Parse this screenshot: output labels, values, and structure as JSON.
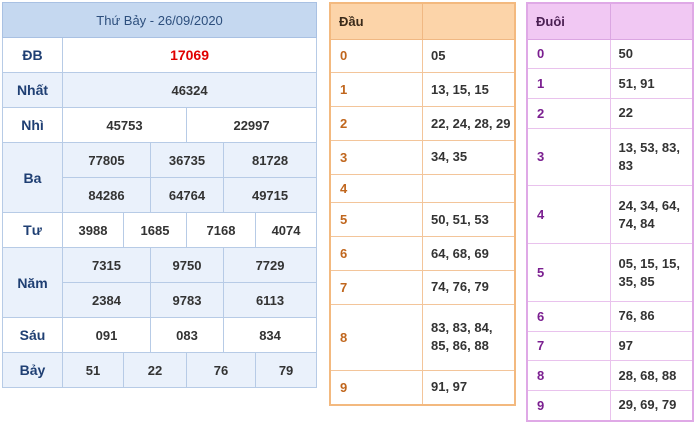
{
  "results": {
    "header": "Thứ Bảy - 26/09/2020",
    "db": {
      "label": "ĐB",
      "values": [
        "17069"
      ]
    },
    "nhat": {
      "label": "Nhất",
      "values": [
        "46324"
      ]
    },
    "nhi": {
      "label": "Nhì",
      "values": [
        "45753",
        "22997"
      ]
    },
    "ba": {
      "label": "Ba",
      "row1": [
        "77805",
        "36735",
        "81728"
      ],
      "row2": [
        "84286",
        "64764",
        "49715"
      ]
    },
    "tu": {
      "label": "Tư",
      "values": [
        "3988",
        "1685",
        "7168",
        "4074"
      ]
    },
    "nam": {
      "label": "Năm",
      "row1": [
        "7315",
        "9750",
        "7729"
      ],
      "row2": [
        "2384",
        "9783",
        "6113"
      ]
    },
    "sau": {
      "label": "Sáu",
      "values": [
        "091",
        "083",
        "834"
      ]
    },
    "bay": {
      "label": "Bảy",
      "values": [
        "51",
        "22",
        "76",
        "79"
      ]
    }
  },
  "dau": {
    "header": "Đầu",
    "rows": [
      {
        "k": "0",
        "v": "05"
      },
      {
        "k": "1",
        "v": "13, 15, 15"
      },
      {
        "k": "2",
        "v": "22, 24, 28, 29"
      },
      {
        "k": "3",
        "v": "34, 35"
      },
      {
        "k": "4",
        "v": ""
      },
      {
        "k": "5",
        "v": "50, 51, 53"
      },
      {
        "k": "6",
        "v": "64, 68, 69"
      },
      {
        "k": "7",
        "v": "74, 76, 79"
      },
      {
        "k": "8",
        "v": "83, 83, 84, 85, 86, 88"
      },
      {
        "k": "9",
        "v": "91, 97"
      }
    ]
  },
  "duoi": {
    "header": "Đuôi",
    "rows": [
      {
        "k": "0",
        "v": "50"
      },
      {
        "k": "1",
        "v": "51, 91"
      },
      {
        "k": "2",
        "v": "22"
      },
      {
        "k": "3",
        "v": "13, 53, 83, 83"
      },
      {
        "k": "4",
        "v": "24, 34, 64, 74, 84"
      },
      {
        "k": "5",
        "v": "05, 15, 15, 35, 85"
      },
      {
        "k": "6",
        "v": "76, 86"
      },
      {
        "k": "7",
        "v": "97"
      },
      {
        "k": "8",
        "v": "28, 68, 88"
      },
      {
        "k": "9",
        "v": "29, 69, 79"
      }
    ]
  },
  "colors": {
    "special_prize": "#e00000",
    "results_header_bg": "#c5d8f0",
    "dau_header_bg": "#fcd4a9",
    "duoi_header_bg": "#f1c8f3"
  }
}
